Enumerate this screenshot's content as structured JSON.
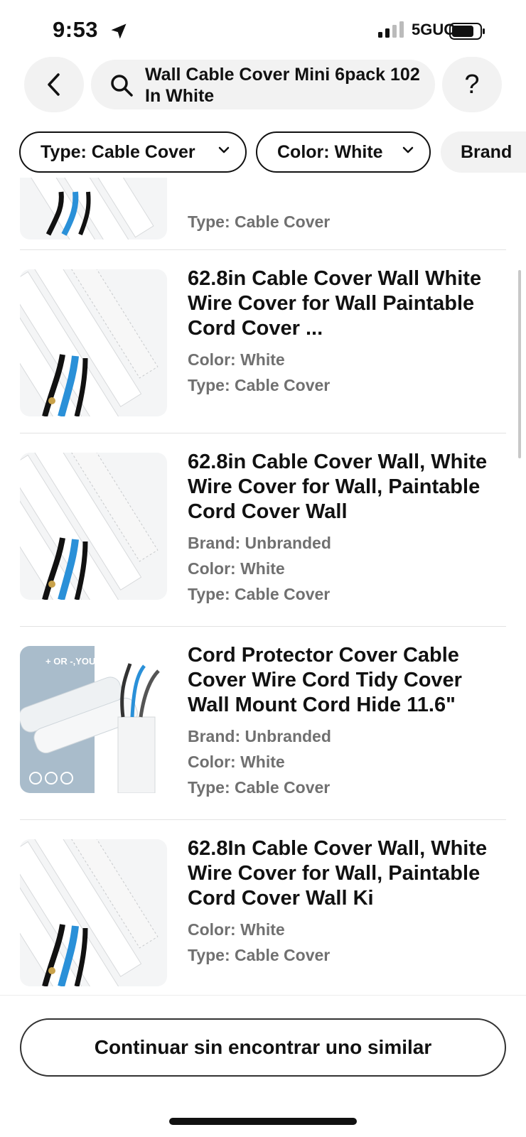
{
  "status_bar": {
    "time": "9:53",
    "network": "5GUC"
  },
  "search": {
    "query": "Wall Cable Cover Mini 6pack 102 In White",
    "help_label": "?"
  },
  "filters": [
    {
      "label": "Type: Cable Cover"
    },
    {
      "label": "Color: White"
    },
    {
      "label": "Brand"
    }
  ],
  "results": [
    {
      "title": "",
      "attributes": [
        "Type: Cable Cover"
      ]
    },
    {
      "title": "62.8in Cable Cover Wall White Wire Cover for Wall Paintable Cord Cover ...",
      "attributes": [
        "Color: White",
        "Type: Cable Cover"
      ]
    },
    {
      "title": "62.8in Cable Cover Wall, White Wire Cover for Wall, Paintable Cord Cover Wall",
      "attributes": [
        "Brand: Unbranded",
        "Color: White",
        "Type: Cable Cover"
      ]
    },
    {
      "title": "Cord Protector Cover Cable Cover Wire Cord Tidy Cover Wall Mount Cord Hide 11.6\"",
      "attributes": [
        "Brand: Unbranded",
        "Color: White",
        "Type: Cable Cover"
      ],
      "image_text": "+ OR -,YOU DECIDE"
    },
    {
      "title": "62.8In Cable Cover Wall, White Wire Cover for Wall, Paintable Cord Cover Wall Ki",
      "attributes": [
        "Color: White",
        "Type: Cable Cover"
      ]
    }
  ],
  "continue_button": "Continuar sin encontrar uno similar",
  "colors": {
    "text": "#111111",
    "secondary_text": "#707070",
    "chip_bg": "#f2f2f2",
    "thumb_bg": "#f4f5f6"
  }
}
